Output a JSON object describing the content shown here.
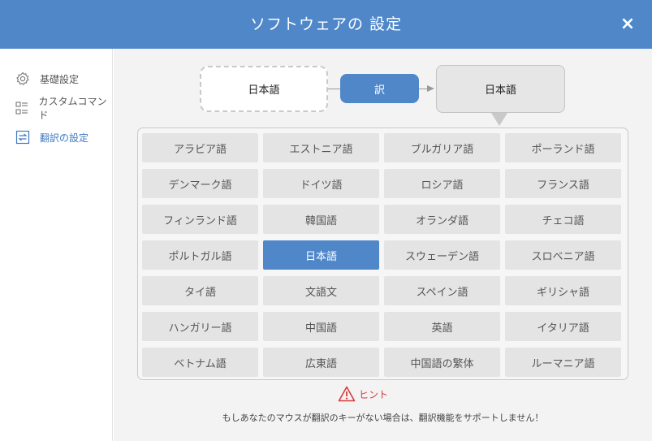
{
  "window": {
    "title": "ソフトウェアの 設定",
    "close_label": "×"
  },
  "sidebar": {
    "items": [
      {
        "label": "基礎設定",
        "icon": "gear-icon",
        "active": false
      },
      {
        "label": "カスタムコマンド",
        "icon": "list-icon",
        "active": false
      },
      {
        "label": "翻訳の設定",
        "icon": "translate-icon",
        "active": true
      }
    ]
  },
  "translation": {
    "source_language": "日本語",
    "translate_button": "訳",
    "target_language": "日本語"
  },
  "languages": [
    "アラビア語",
    "エストニア語",
    "ブルガリア語",
    "ポーランド語",
    "デンマーク語",
    "ドイツ語",
    "ロシア語",
    "フランス語",
    "フィンランド語",
    "韓国語",
    "オランダ語",
    "チェコ語",
    "ポルトガル語",
    "日本語",
    "スウェーデン語",
    "スロベニア語",
    "タイ語",
    "文語文",
    "スペイン語",
    "ギリシャ語",
    "ハンガリー語",
    "中国語",
    "英語",
    "イタリア語",
    "ベトナム語",
    "広東語",
    "中国語の繁体",
    "ルーマニア語"
  ],
  "selected_language_index": 13,
  "hint": {
    "label": "ヒント",
    "icon": "warning-icon"
  },
  "note": "もしあなたのマウスが翻訳のキーがない場合は、翻訳機能をサポートしません！",
  "colors": {
    "accent": "#4f87c9",
    "hint": "#d93a3a"
  }
}
